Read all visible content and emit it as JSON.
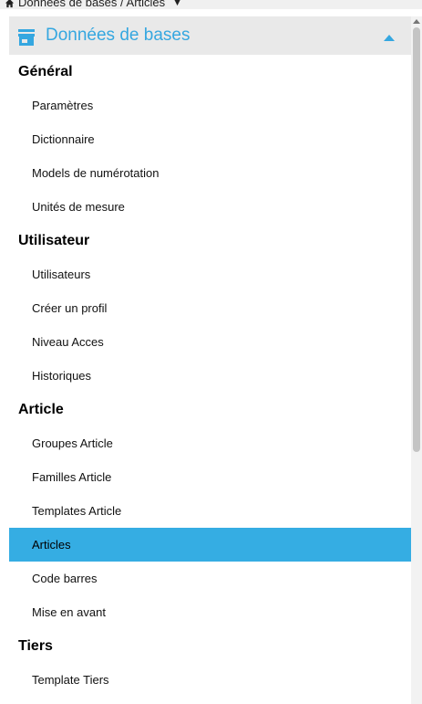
{
  "breadcrumb": {
    "path": "Données de bases / Articles",
    "caret": "▼"
  },
  "panel": {
    "title": "Données de bases",
    "accent_color": "#35a7e0",
    "active_color": "#35ade3"
  },
  "sections": [
    {
      "title": "Général",
      "items": [
        {
          "label": "Paramètres"
        },
        {
          "label": "Dictionnaire"
        },
        {
          "label": "Models de numérotation"
        },
        {
          "label": "Unités de mesure"
        }
      ]
    },
    {
      "title": "Utilisateur",
      "items": [
        {
          "label": "Utilisateurs"
        },
        {
          "label": "Créer un profil"
        },
        {
          "label": "Niveau Acces"
        },
        {
          "label": "Historiques"
        }
      ]
    },
    {
      "title": "Article",
      "items": [
        {
          "label": "Groupes Article"
        },
        {
          "label": "Familles Article"
        },
        {
          "label": "Templates Article"
        },
        {
          "label": "Articles",
          "active": true
        },
        {
          "label": "Code barres"
        },
        {
          "label": "Mise en avant"
        }
      ]
    },
    {
      "title": "Tiers",
      "items": [
        {
          "label": "Template Tiers"
        }
      ]
    }
  ]
}
